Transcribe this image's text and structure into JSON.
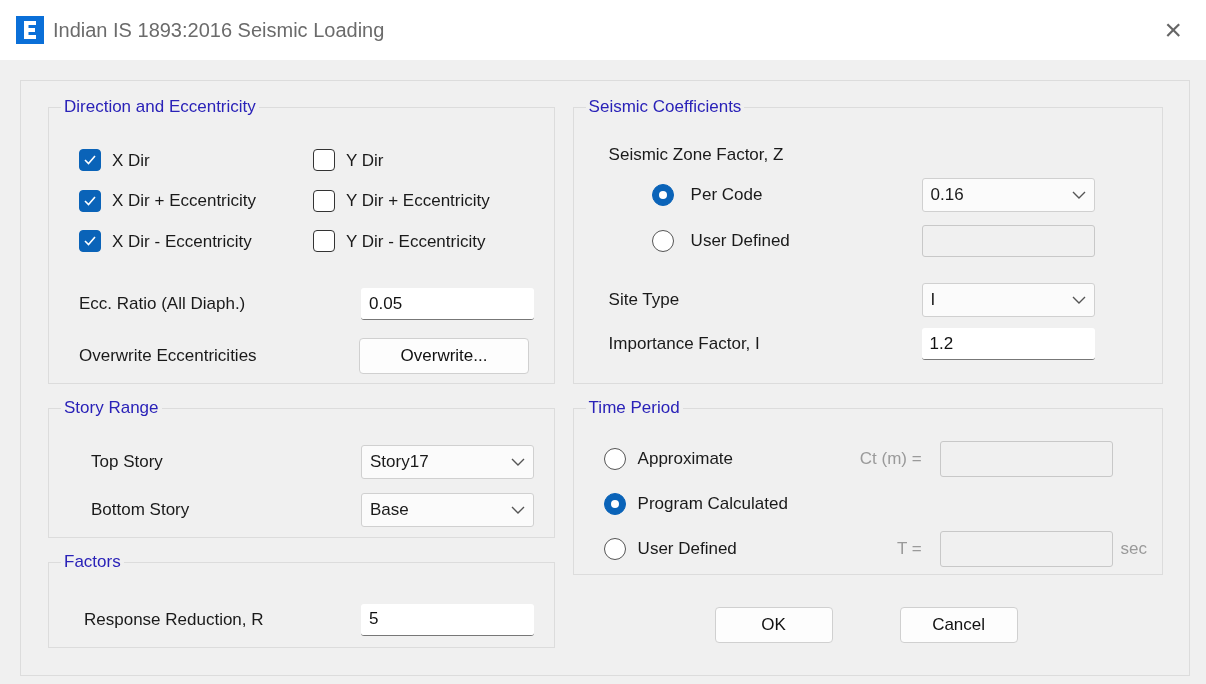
{
  "window": {
    "title": "Indian IS 1893:2016 Seismic Loading",
    "close": "×"
  },
  "direction_and_eccentricity": {
    "title": "Direction and Eccentricity",
    "checkboxes": [
      {
        "label": "X Dir",
        "checked": true
      },
      {
        "label": "Y Dir",
        "checked": false
      },
      {
        "label": "X Dir + Eccentricity",
        "checked": true
      },
      {
        "label": "Y Dir + Eccentricity",
        "checked": false
      },
      {
        "label": "X Dir - Eccentricity",
        "checked": true
      },
      {
        "label": "Y Dir - Eccentricity",
        "checked": false
      }
    ],
    "ecc_ratio": {
      "label": "Ecc. Ratio (All Diaph.)",
      "value": "0.05"
    },
    "overwrite": {
      "label": "Overwrite Eccentricities",
      "button": "Overwrite..."
    }
  },
  "story_range": {
    "title": "Story Range",
    "fields": [
      {
        "label": "Top Story",
        "value": "Story17"
      },
      {
        "label": "Bottom Story",
        "value": "Base"
      }
    ]
  },
  "factors": {
    "title": "Factors",
    "fields": [
      {
        "label": "Response Reduction, R",
        "value": "5"
      }
    ]
  },
  "seismic_coefficients": {
    "title": "Seismic Coefficients",
    "zone_factor_label": "Seismic Zone Factor, Z",
    "options": [
      {
        "label": "Per Code",
        "selected": true,
        "kind": "dropdown",
        "value": "0.16"
      },
      {
        "label": "User Defined",
        "selected": false,
        "kind": "field"
      }
    ],
    "fields": [
      {
        "label": "Site Type",
        "kind": "dropdown",
        "value": "I"
      },
      {
        "label": "Importance Factor, I",
        "kind": "field",
        "value": "1.2"
      }
    ]
  },
  "time_period": {
    "title": "Time Period",
    "options": [
      {
        "label": "Approximate",
        "selected": false,
        "field_label": "Ct (m) ="
      },
      {
        "label": "Program Calculated",
        "selected": true
      },
      {
        "label": "User Defined",
        "selected": false,
        "field_label": "T =",
        "unit": "sec"
      }
    ]
  },
  "buttons": [
    "OK",
    "Cancel"
  ]
}
